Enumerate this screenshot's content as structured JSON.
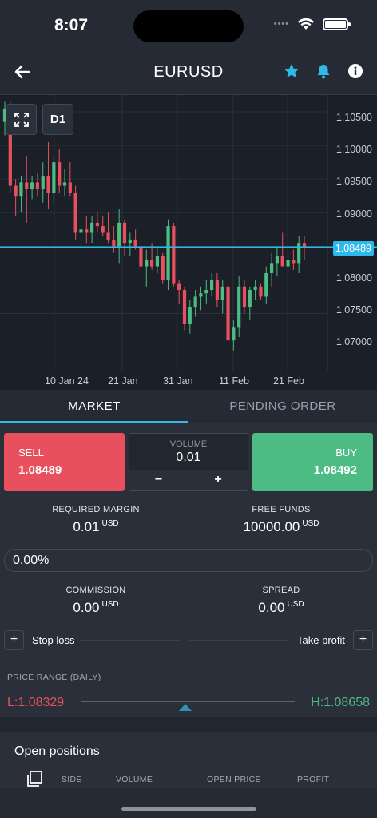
{
  "status_bar": {
    "time": "8:07",
    "signal_dots": "••••"
  },
  "nav": {
    "title": "EURUSD"
  },
  "chart": {
    "timeframe": "D1",
    "y_ticks": [
      "1.10500",
      "1.10000",
      "1.09500",
      "1.09000",
      "1.08000",
      "1.07500",
      "1.07000"
    ],
    "x_ticks": [
      "10 Jan 24",
      "21 Jan",
      "31 Jan",
      "11 Feb",
      "21 Feb"
    ],
    "current_price": "1.08489"
  },
  "chart_data": {
    "type": "candlestick",
    "ylim": [
      1.0665,
      1.1075
    ],
    "y_ticks": [
      1.105,
      1.1,
      1.095,
      1.09,
      1.085,
      1.08,
      1.075,
      1.07
    ],
    "current_price": 1.08489,
    "candles": [
      [
        1.1035,
        1.1065,
        1.1015,
        1.1055
      ],
      [
        1.1055,
        1.1065,
        1.093,
        1.094
      ],
      [
        1.094,
        1.095,
        1.0895,
        1.0925
      ],
      [
        1.0925,
        1.0955,
        1.09,
        1.0945
      ],
      [
        1.0945,
        1.0985,
        1.0885,
        1.0935
      ],
      [
        1.0935,
        1.0955,
        1.092,
        1.0945
      ],
      [
        1.0945,
        1.096,
        1.0925,
        1.0935
      ],
      [
        1.0935,
        1.0975,
        1.0915,
        1.0955
      ],
      [
        1.0955,
        1.1005,
        1.0905,
        1.093
      ],
      [
        1.093,
        1.0985,
        1.0915,
        1.0975
      ],
      [
        1.0975,
        1.0995,
        1.093,
        1.094
      ],
      [
        1.094,
        1.0965,
        1.0925,
        1.0945
      ],
      [
        1.0945,
        1.0975,
        1.0925,
        1.093
      ],
      [
        1.093,
        1.094,
        1.086,
        1.087
      ],
      [
        1.087,
        1.0885,
        1.0845,
        1.0875
      ],
      [
        1.0875,
        1.0895,
        1.0855,
        1.087
      ],
      [
        1.087,
        1.0895,
        1.0855,
        1.0885
      ],
      [
        1.0885,
        1.09,
        1.087,
        1.088
      ],
      [
        1.088,
        1.0895,
        1.0865,
        1.087
      ],
      [
        1.087,
        1.09,
        1.0855,
        1.086
      ],
      [
        1.086,
        1.088,
        1.084,
        1.085
      ],
      [
        1.085,
        1.0905,
        1.0825,
        1.0885
      ],
      [
        1.0885,
        1.089,
        1.0835,
        1.0855
      ],
      [
        1.0855,
        1.087,
        1.0835,
        1.086
      ],
      [
        1.086,
        1.0875,
        1.0845,
        1.085
      ],
      [
        1.085,
        1.086,
        1.081,
        1.082
      ],
      [
        1.082,
        1.0845,
        1.079,
        1.083
      ],
      [
        1.083,
        1.0855,
        1.0815,
        1.082
      ],
      [
        1.082,
        1.085,
        1.081,
        1.0835
      ],
      [
        1.0835,
        1.084,
        1.0795,
        1.08
      ],
      [
        1.08,
        1.089,
        1.0785,
        1.088
      ],
      [
        1.088,
        1.0885,
        1.079,
        1.0795
      ],
      [
        1.0795,
        1.08,
        1.0765,
        1.0785
      ],
      [
        1.0785,
        1.079,
        1.0725,
        1.0735
      ],
      [
        1.0735,
        1.077,
        1.072,
        1.076
      ],
      [
        1.076,
        1.0785,
        1.0745,
        1.0775
      ],
      [
        1.0775,
        1.079,
        1.0755,
        1.078
      ],
      [
        1.078,
        1.08,
        1.0765,
        1.0785
      ],
      [
        1.0785,
        1.081,
        1.0775,
        1.08
      ],
      [
        1.08,
        1.081,
        1.076,
        1.077
      ],
      [
        1.077,
        1.08,
        1.075,
        1.079
      ],
      [
        1.079,
        1.0795,
        1.07,
        1.071
      ],
      [
        1.071,
        1.074,
        1.0695,
        1.073
      ],
      [
        1.073,
        1.0805,
        1.0715,
        1.079
      ],
      [
        1.079,
        1.08,
        1.075,
        1.076
      ],
      [
        1.076,
        1.079,
        1.074,
        1.0785
      ],
      [
        1.0785,
        1.08,
        1.077,
        1.079
      ],
      [
        1.079,
        1.0795,
        1.077,
        1.0775
      ],
      [
        1.0775,
        1.082,
        1.0765,
        1.081
      ],
      [
        1.081,
        1.084,
        1.079,
        1.0825
      ],
      [
        1.0825,
        1.085,
        1.0805,
        1.0835
      ],
      [
        1.0835,
        1.087,
        1.082,
        1.082
      ],
      [
        1.082,
        1.084,
        1.081,
        1.083
      ],
      [
        1.083,
        1.0845,
        1.0815,
        1.0825
      ],
      [
        1.0825,
        1.0865,
        1.081,
        1.0855
      ],
      [
        1.0855,
        1.0865,
        1.083,
        1.0849
      ]
    ]
  },
  "tabs": {
    "market": "MARKET",
    "pending": "PENDING ORDER"
  },
  "trade": {
    "sell_label": "SELL",
    "sell_price": "1.08489",
    "buy_label": "BUY",
    "buy_price": "1.08492",
    "volume_label": "VOLUME",
    "volume_value": "0.01",
    "minus": "−",
    "plus": "+"
  },
  "margin": {
    "required_label": "REQUIRED MARGIN",
    "required_value": "0.01",
    "required_unit": "USD",
    "free_label": "FREE FUNDS",
    "free_value": "10000.00",
    "free_unit": "USD"
  },
  "percent": {
    "value": "0.00%"
  },
  "costs": {
    "commission_label": "COMMISSION",
    "commission_value": "0.00",
    "commission_unit": "USD",
    "spread_label": "SPREAD",
    "spread_value": "0.00",
    "spread_unit": "USD"
  },
  "sltp": {
    "stop_loss": "Stop loss",
    "take_profit": "Take profit",
    "plus": "+"
  },
  "range": {
    "label": "PRICE RANGE (DAILY)",
    "low": "L:1.08329",
    "high": "H:1.08658",
    "low_value": 1.08329,
    "high_value": 1.08658,
    "current_value": 1.08489
  },
  "positions": {
    "title": "Open positions",
    "columns": [
      "SIDE",
      "VOLUME",
      "OPEN PRICE",
      "PROFIT"
    ]
  },
  "colors": {
    "bull": "#4dbb84",
    "bear": "#e8505d",
    "accent": "#2fb9ea",
    "grid": "#2a2f3a"
  }
}
